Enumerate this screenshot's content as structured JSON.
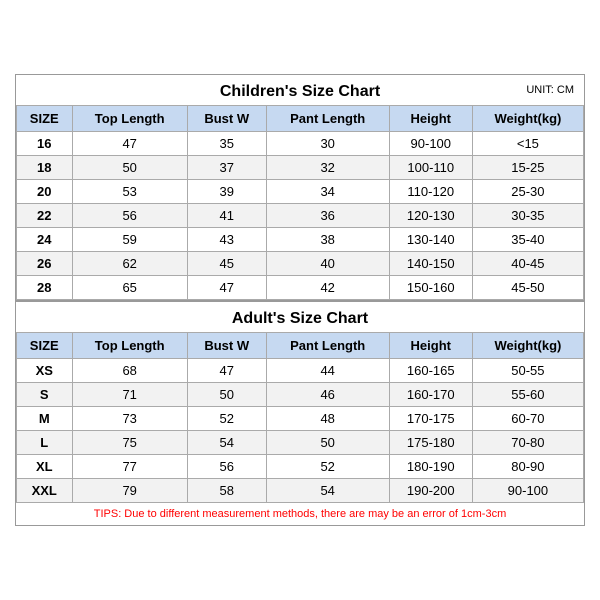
{
  "children": {
    "title": "Children's Size Chart",
    "unit": "UNIT: CM",
    "columns": [
      "SIZE",
      "Top Length",
      "Bust W",
      "Pant Length",
      "Height",
      "Weight(kg)"
    ],
    "rows": [
      [
        "16",
        "47",
        "35",
        "30",
        "90-100",
        "<15"
      ],
      [
        "18",
        "50",
        "37",
        "32",
        "100-110",
        "15-25"
      ],
      [
        "20",
        "53",
        "39",
        "34",
        "110-120",
        "25-30"
      ],
      [
        "22",
        "56",
        "41",
        "36",
        "120-130",
        "30-35"
      ],
      [
        "24",
        "59",
        "43",
        "38",
        "130-140",
        "35-40"
      ],
      [
        "26",
        "62",
        "45",
        "40",
        "140-150",
        "40-45"
      ],
      [
        "28",
        "65",
        "47",
        "42",
        "150-160",
        "45-50"
      ]
    ]
  },
  "adults": {
    "title": "Adult's Size Chart",
    "columns": [
      "SIZE",
      "Top Length",
      "Bust W",
      "Pant Length",
      "Height",
      "Weight(kg)"
    ],
    "rows": [
      [
        "XS",
        "68",
        "47",
        "44",
        "160-165",
        "50-55"
      ],
      [
        "S",
        "71",
        "50",
        "46",
        "160-170",
        "55-60"
      ],
      [
        "M",
        "73",
        "52",
        "48",
        "170-175",
        "60-70"
      ],
      [
        "L",
        "75",
        "54",
        "50",
        "175-180",
        "70-80"
      ],
      [
        "XL",
        "77",
        "56",
        "52",
        "180-190",
        "80-90"
      ],
      [
        "XXL",
        "79",
        "58",
        "54",
        "190-200",
        "90-100"
      ]
    ]
  },
  "tips": "TIPS: Due to different measurement methods, there are may be an error of 1cm-3cm"
}
